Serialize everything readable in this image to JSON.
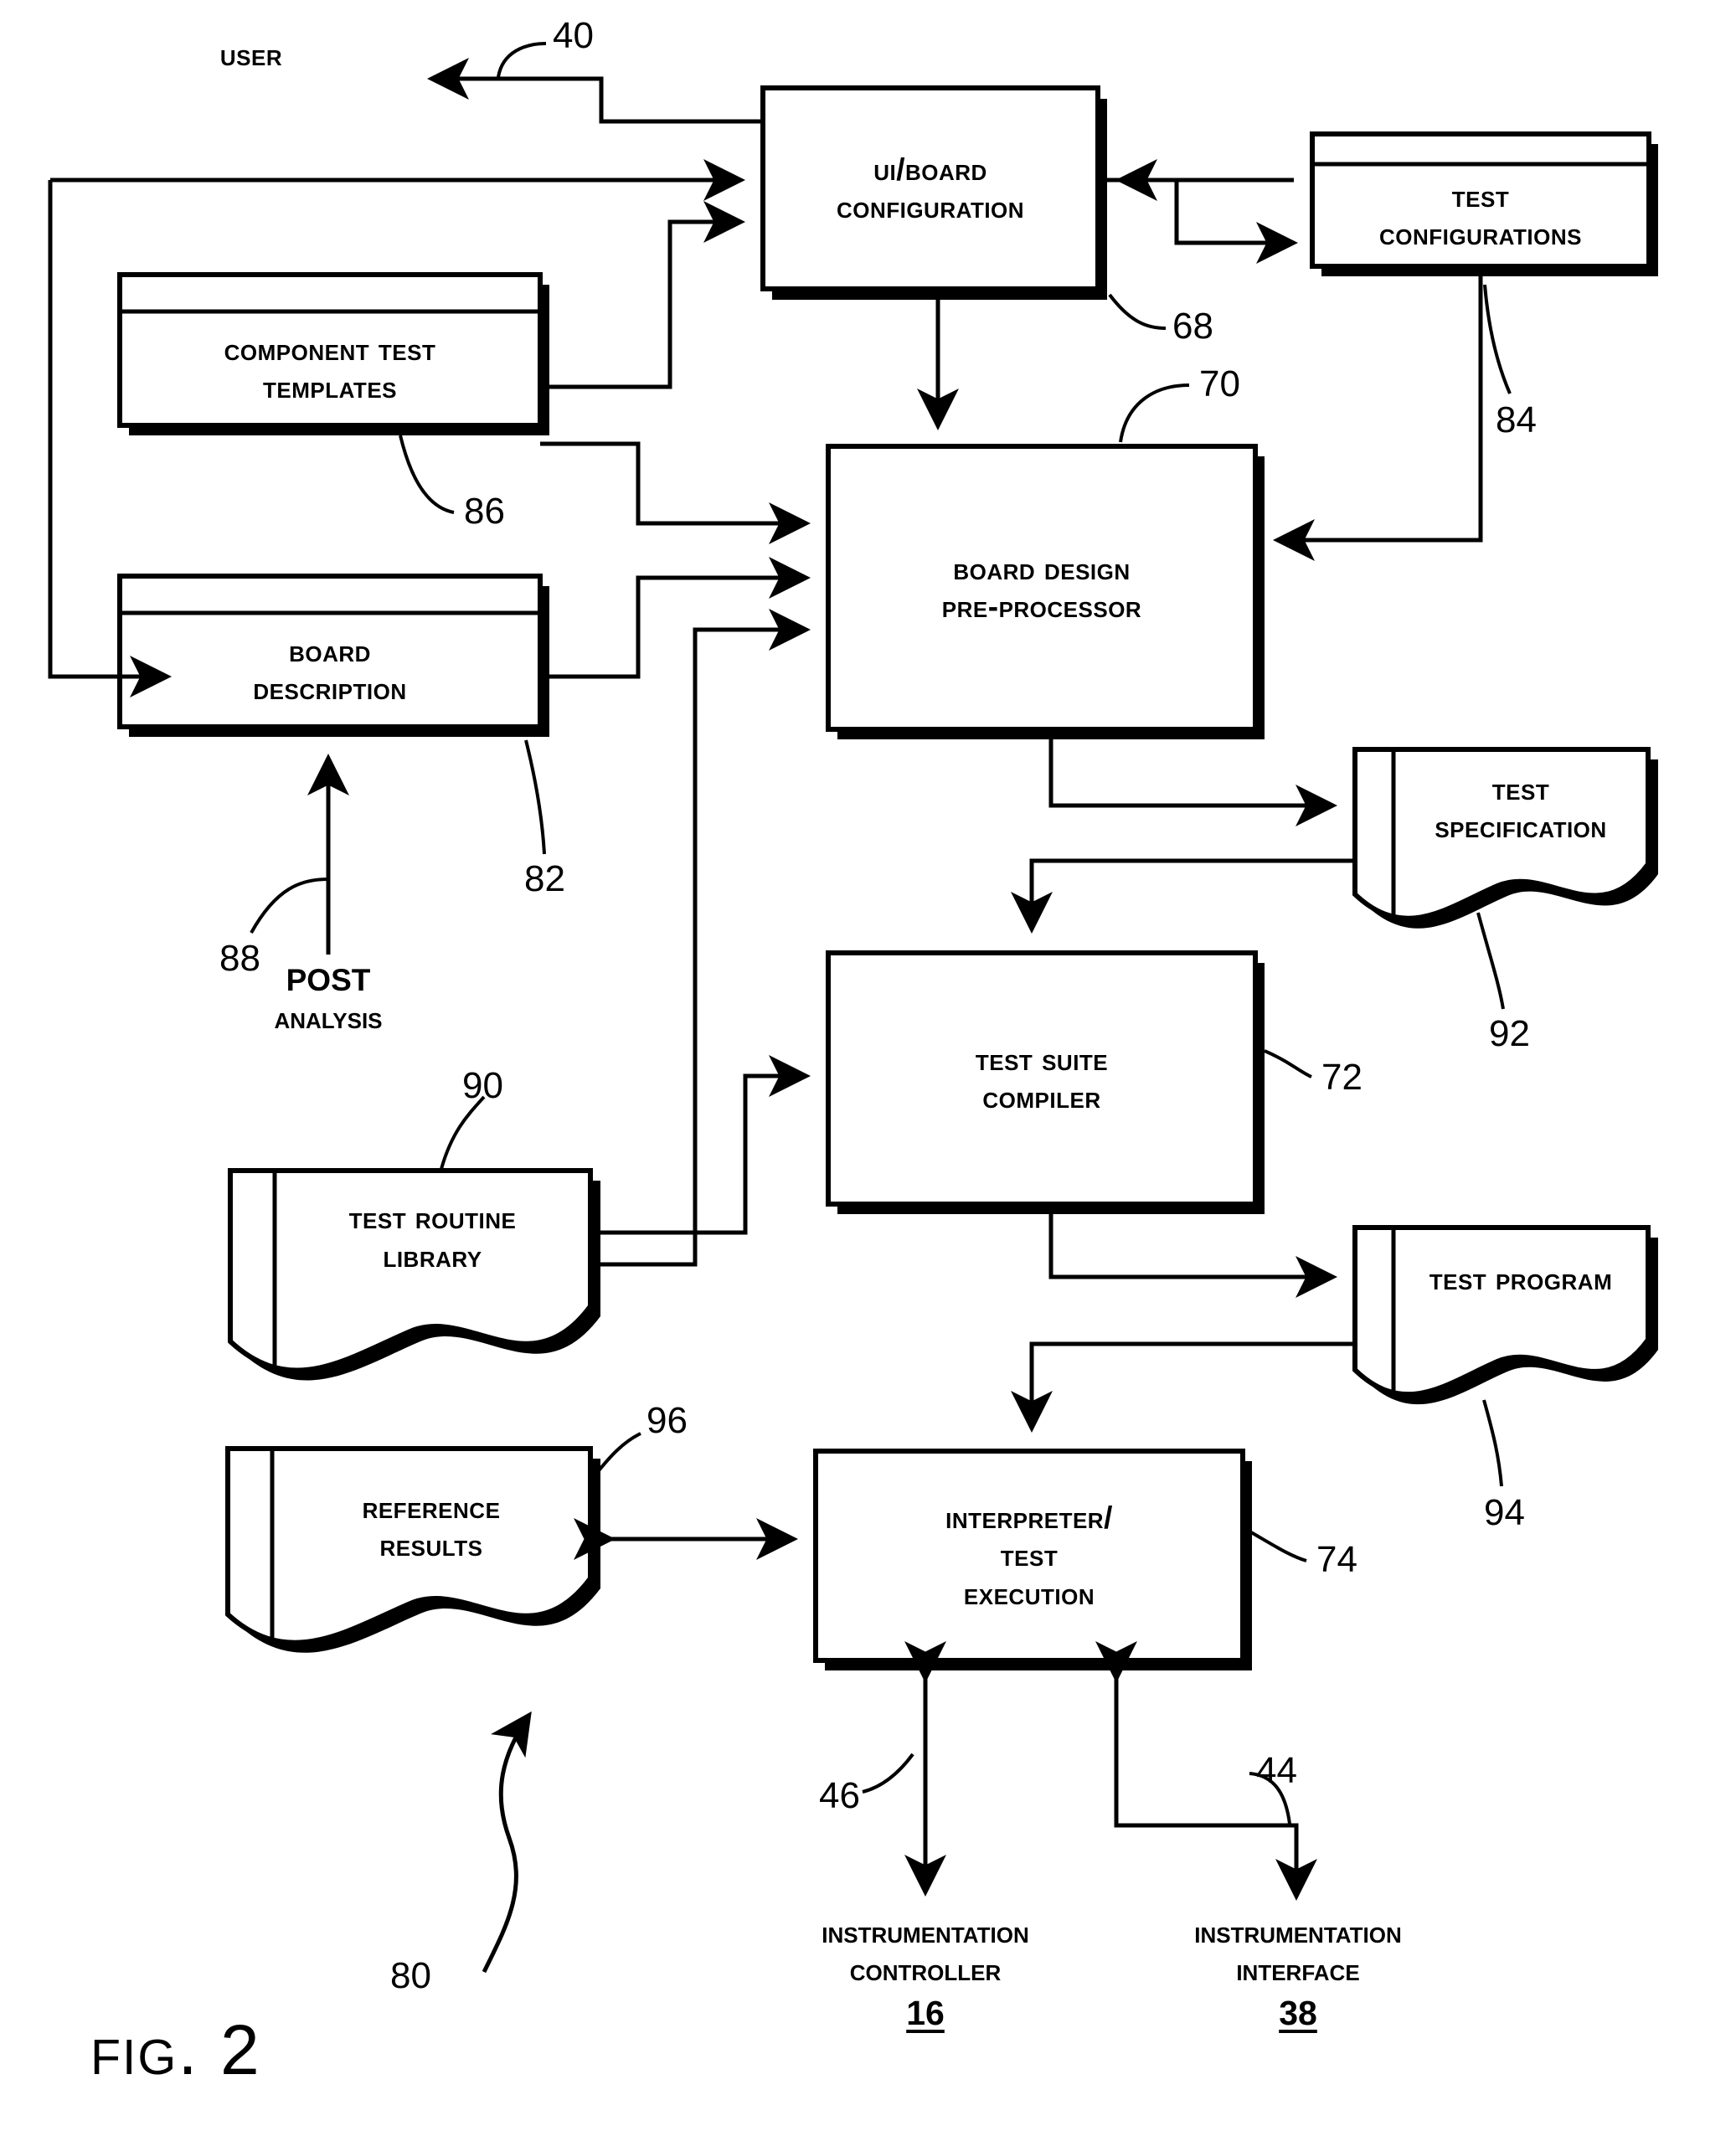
{
  "figure": {
    "caption": "Fig. 2",
    "overall_ref": "80"
  },
  "nodes": {
    "user": {
      "label": "User",
      "ref": "40"
    },
    "ui_board_configuration": {
      "line1": "UI/Board",
      "line2": "Configuration",
      "ref": "68",
      "shape": "process-box"
    },
    "test_configurations": {
      "line1": "Test",
      "line2": "Configurations",
      "ref": "84",
      "shape": "store-box"
    },
    "component_test_templates": {
      "line1": "Component Test",
      "line2": "Templates",
      "ref": "86",
      "shape": "store-box"
    },
    "board_description": {
      "line1": "Board",
      "line2": "Description",
      "ref": "82",
      "shape": "store-box"
    },
    "post_analysis": {
      "line1": "POST",
      "line2": "Analysis",
      "ref": "88"
    },
    "board_design_preprocessor": {
      "line1": "Board Design",
      "line2": "Pre-Processor",
      "ref": "70",
      "shape": "process-box"
    },
    "test_specification": {
      "line1": "Test",
      "line2": "Specification",
      "ref": "92",
      "shape": "document"
    },
    "test_suite_compiler": {
      "line1": "Test Suite",
      "line2": "Compiler",
      "ref": "72",
      "shape": "process-box"
    },
    "test_routine_library": {
      "line1": "Test Routine",
      "line2": "Library",
      "ref": "90",
      "shape": "document"
    },
    "test_program": {
      "line1": "Test Program",
      "line2": "",
      "ref": "94",
      "shape": "document"
    },
    "reference_results": {
      "line1": "Reference",
      "line2": "Results",
      "ref": "96",
      "shape": "document"
    },
    "interpreter_test_execution": {
      "line1": "Interpreter/",
      "line2": "Test",
      "line3": "Execution",
      "ref": "74",
      "shape": "process-box"
    },
    "instrumentation_controller": {
      "line1": "Instrumentation",
      "line2": "Controller",
      "num": "16",
      "ref": "46"
    },
    "instrumentation_interface": {
      "line1": "Instrumentation",
      "line2": "Interface",
      "num": "38",
      "ref": "44"
    }
  },
  "colors": {
    "ink": "#000000",
    "paper": "#ffffff"
  }
}
